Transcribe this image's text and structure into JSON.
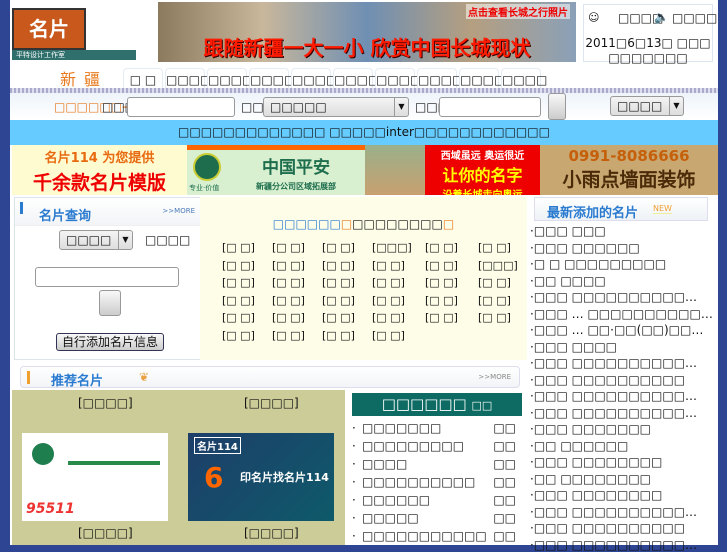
{
  "logo": {
    "text": "名片114",
    "sub": "平特设计工作室"
  },
  "banner": {
    "title": "跟随新疆一大一小 欣赏中国长城现状",
    "link": "点击查看长城之行照片"
  },
  "topright": {
    "login": "□□□□",
    "sound": "□□□□",
    "date": "2011□6□13□ □□□",
    "weekday": "□□□□□□□"
  },
  "nav": {
    "region": "新疆",
    "tabs": [
      "□ □",
      "□□□□",
      "□□□□",
      "□□□□",
      "□□□□",
      "□□□□",
      "□□□□",
      "□□□□",
      "□□□□",
      "□□□□"
    ]
  },
  "search": {
    "prompt": "□□□□□□→",
    "label1": "□□□",
    "label2": "□□□",
    "select_value": "□□□□□",
    "label3": "□□□",
    "right_select": "□□□□"
  },
  "notice": "□□□□□□□□□□□□□ □□□□□inter□□□□□□□□□□□□",
  "ads": [
    {
      "line1": "名片114 为您提供",
      "line2": "千余款名片模版"
    },
    {
      "line1": "中国平安",
      "line2": "新疆分公司区域拓展部",
      "line3": "专业·价值"
    },
    {
      "line1": ""
    },
    {
      "line1": "西域虽远 奥运很近",
      "line2": "让你的名字",
      "line3": "沿着长城走向奥运"
    },
    {
      "line1": "0991-8086666",
      "line2": "小雨点墙面装饰"
    }
  ],
  "query": {
    "title": "名片查询",
    "more": ">>MORE",
    "select_value": "□□□□",
    "label": "□□□□",
    "add_button": "自行添加名片信息"
  },
  "center": {
    "title_blue": "□□□□□□",
    "title_orange1": "□",
    "title_rest": "□□□□□□□□",
    "title_orange2": "□",
    "grid": [
      [
        "[□ □]",
        "[□ □]",
        "[□ □]",
        "[□□□]",
        "[□ □]",
        "[□ □]"
      ],
      [
        "[□ □]",
        "[□ □]",
        "[□ □]",
        "[□ □]",
        "[□ □]",
        "[□□□]"
      ],
      [
        "[□ □]",
        "[□ □]",
        "[□ □]",
        "[□ □]",
        "[□ □]",
        "[□ □]"
      ],
      [
        "[□ □]",
        "[□ □]",
        "[□ □]",
        "[□ □]",
        "[□ □]",
        "[□ □]"
      ],
      [
        "[□ □]",
        "[□ □]",
        "[□ □]",
        "[□ □]",
        "[□ □]",
        "[□ □]"
      ],
      [
        "[□ □]",
        "[□ □]",
        "[□ □]",
        "[□ □]"
      ]
    ]
  },
  "latest": {
    "title": "最新添加的名片",
    "badge": "NEW",
    "items": [
      "□□□ □□□",
      "□□□ □□□□□□",
      "□ □ □□□□□□□□□",
      "□□ □□□□",
      "□□□ □□□□□□□□□□…",
      "□□□ … □□□□□□□□□□…",
      "□□□ … □□·□□(□□)□□…",
      "□□□ □□□□",
      "□□□ □□□□□□□□□□…",
      "□□□ □□□□□□□□□□",
      "□□□ □□□□□□□□□□…",
      "□□□ □□□□□□□□□□…",
      "□□□ □□□□□□□",
      "□□ □□□□□□",
      "□□□ □□□□□□□□",
      "□□ □□□□□□□□",
      "□□□ □□□□□□□□",
      "□□□ □□□□□□□□□□…",
      "□□□ □□□□□□□□□□",
      "□□□ □□□□□□□□□□…"
    ]
  },
  "recommend": {
    "title": "推荐名片",
    "more": ">>MORE",
    "cards": [
      {
        "top": "[□□□□]",
        "bottom": "[□□□□]"
      },
      {
        "top": "[□□□□]",
        "bottom": "[□□□□]",
        "text": "印名片找名片114",
        "brand": "名片114"
      }
    ]
  },
  "ranking": {
    "title": "□□□□□□",
    "suffix": "□□",
    "items": [
      {
        "name": "□□□□□□□",
        "count": "□□"
      },
      {
        "name": "□□□□□□□□□",
        "count": "□□"
      },
      {
        "name": "□□□□",
        "count": "□□"
      },
      {
        "name": "□□□□□□□□□□",
        "count": "□□"
      },
      {
        "name": "□□□□□□",
        "count": "□□"
      },
      {
        "name": "□□□□□",
        "count": "□□"
      },
      {
        "name": "□□□□□□□□□□□",
        "count": "□□"
      }
    ]
  }
}
